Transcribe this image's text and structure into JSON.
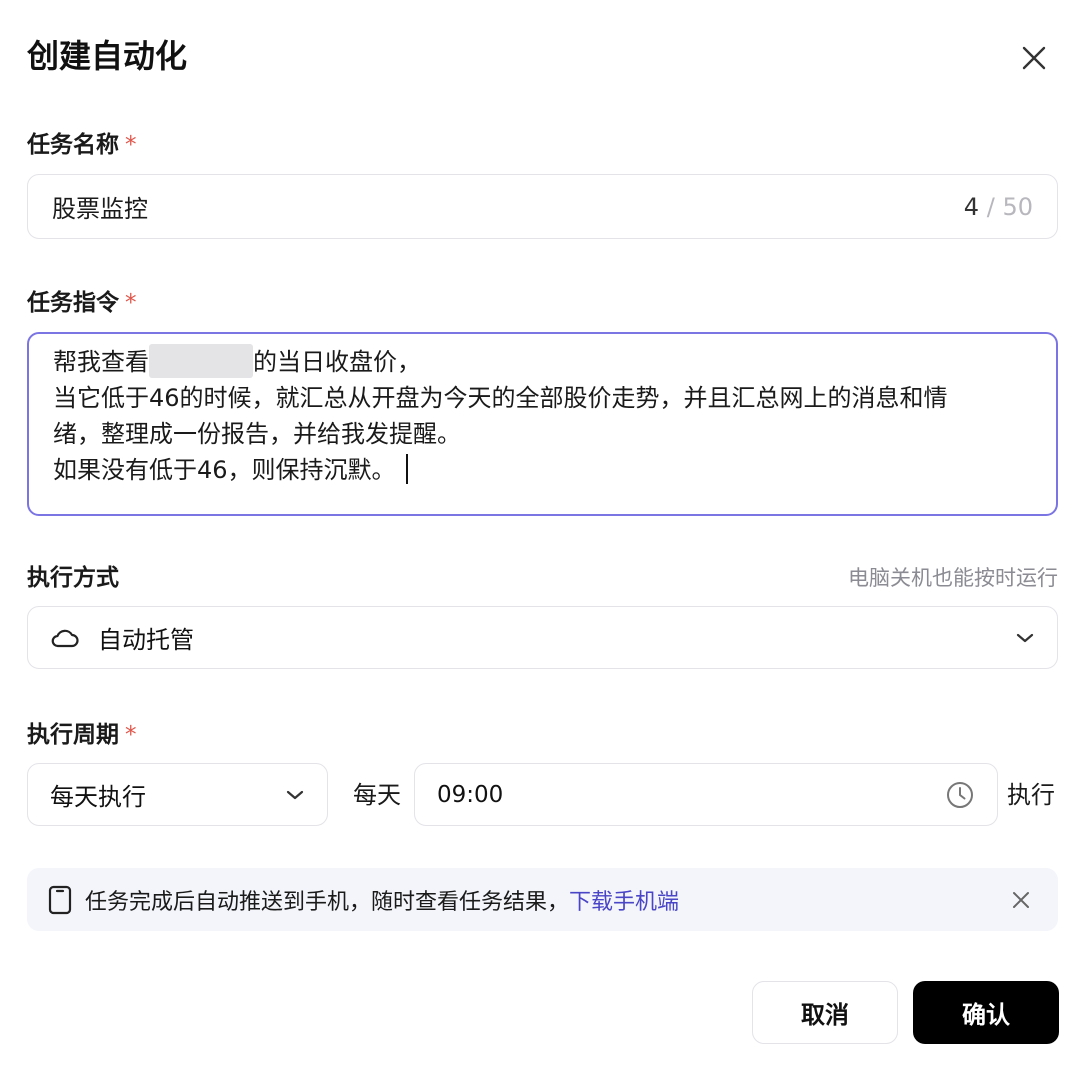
{
  "dialog": {
    "title": "创建自动化"
  },
  "task_name": {
    "label": "任务名称",
    "required_mark": "*",
    "value": "股票监控",
    "count": "4",
    "separator": "/",
    "max": "50"
  },
  "task_prompt": {
    "label": "任务指令",
    "required_mark": "*",
    "line1_start": "帮我查看",
    "line1_end": "的当日收盘价，",
    "line2": "当它低于46的时候，就汇总从开盘为今天的全部股价走势，并且汇总网上的消息和情",
    "line3": "绪，整理成一份报告，并给我发提醒。",
    "line4": "如果没有低于46，则保持沉默。"
  },
  "exec_mode": {
    "label": "执行方式",
    "hint": "电脑关机也能按时运行",
    "value": "自动托管",
    "icon": "cloud-icon"
  },
  "exec_period": {
    "label": "执行周期",
    "required_mark": "*",
    "frequency": "每天执行",
    "prefix": "每天",
    "time": "09:00",
    "suffix": "执行"
  },
  "banner": {
    "icon": "phone-icon",
    "message": "任务完成后自动推送到手机，随时查看任务结果，",
    "link": "下载手机端"
  },
  "footer": {
    "cancel_label": "取消",
    "confirm_label": "确认"
  },
  "colors": {
    "accent": "#7b74e3",
    "link": "#4a45c7",
    "required": "#e0564b",
    "confirm_bg": "#000000"
  }
}
